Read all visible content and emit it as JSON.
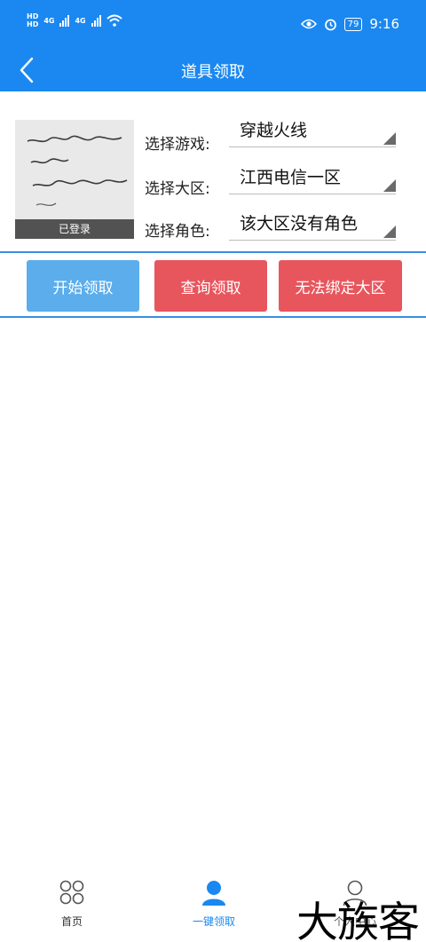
{
  "status_bar": {
    "sim_tags": [
      "HD",
      "HD"
    ],
    "network": [
      "4G",
      "4G"
    ],
    "battery": "79",
    "time": "9:16",
    "icons": [
      "eye-icon",
      "alarm-icon",
      "wifi-icon",
      "signal-icon",
      "battery-icon"
    ]
  },
  "header": {
    "title": "道具领取",
    "back_icon": "chevron-left-icon"
  },
  "profile": {
    "status_label": "已登录"
  },
  "selectors": [
    {
      "label": "选择游戏:",
      "value": "穿越火线"
    },
    {
      "label": "选择大区:",
      "value": "江西电信一区"
    },
    {
      "label": "选择角色:",
      "value": "该大区没有角色"
    }
  ],
  "actions": {
    "start": "开始领取",
    "query": "查询领取",
    "cannot_bind": "无法绑定大区"
  },
  "tabs": [
    {
      "label": "首页",
      "icon": "grid-circles-icon"
    },
    {
      "label": "一键领取",
      "icon": "user-filled-icon",
      "active": true
    },
    {
      "label": "个人中心",
      "icon": "user-outline-icon"
    }
  ],
  "watermark": "大族客",
  "colors": {
    "primary": "#1a88f0",
    "start_button": "#5badec",
    "danger_button": "#e8565d",
    "divider": "#3a8ee0"
  }
}
